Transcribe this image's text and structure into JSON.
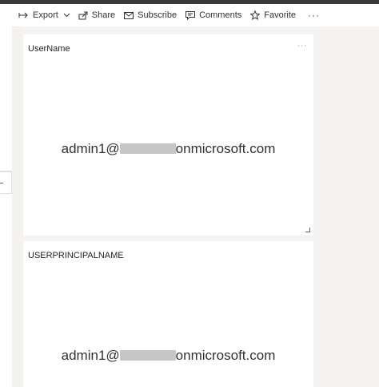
{
  "toolbar": {
    "items": [
      {
        "label": "Export",
        "icon": "export-icon"
      },
      {
        "label": "Share",
        "icon": "share-icon"
      },
      {
        "label": "Subscribe",
        "icon": "subscribe-icon"
      },
      {
        "label": "Comments",
        "icon": "comments-icon"
      },
      {
        "label": "Favorite",
        "icon": "star-icon"
      }
    ],
    "more_label": "···"
  },
  "cards": [
    {
      "title": "UserName",
      "value_prefix": "admin1@",
      "value_suffix": "onmicrosoft.com",
      "more_label": "···"
    },
    {
      "title": "USERPRINCIPALNAME",
      "value_prefix": "admin1@",
      "value_suffix": "onmicrosoft.com"
    }
  ],
  "colors": {
    "accent": "#252423",
    "topbar": "#3b3a39",
    "canvas": "#f3f2f1",
    "redaction": "#c8c6c4"
  }
}
